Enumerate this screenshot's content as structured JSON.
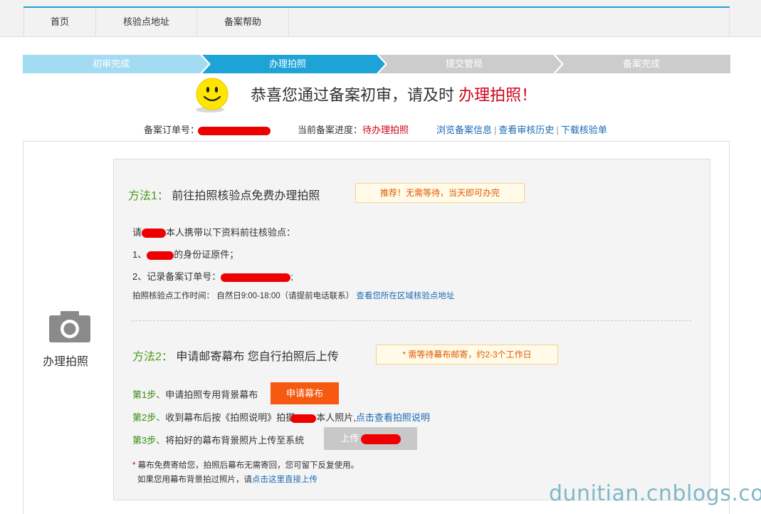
{
  "nav": {
    "items": [
      {
        "label": "首页"
      },
      {
        "label": "核验点地址"
      },
      {
        "label": "备案帮助"
      }
    ]
  },
  "steps": [
    {
      "label": "初审完成",
      "state": "done"
    },
    {
      "label": "办理拍照",
      "state": "current"
    },
    {
      "label": "提交管局",
      "state": "todo"
    },
    {
      "label": "备案完成",
      "state": "todo"
    }
  ],
  "colors": {
    "step_done": "#a3dcf2",
    "step_current": "#1ea3d6",
    "step_todo": "#cccccc",
    "accent_red": "#d0021b",
    "orange_button": "#f55a10",
    "method_green": "#4a9a1a",
    "link_blue": "#1a6bb5"
  },
  "congrats": {
    "text": "恭喜您通过备案初审，请及时",
    "highlight": "办理拍照！"
  },
  "order": {
    "label": "备案订单号：",
    "progress_label": "当前备案进度：",
    "progress_value": "待办理拍照",
    "links": [
      "浏览备案信息",
      "查看审核历史",
      "下载核验单"
    ]
  },
  "side": {
    "icon": "camera-icon",
    "label": "办理拍照"
  },
  "method1": {
    "prefix": "方法1：",
    "title": "前往拍照核验点免费办理拍照",
    "tag": "推荐！无需等待，当天即可办完",
    "intro_a": "请",
    "intro_b": "本人携带以下资料前往核验点：",
    "item1_a": "1、",
    "item1_b": "的身份证原件；",
    "item2_a": "2、记录备案订单号：",
    "item2_b": ";",
    "hours": "拍照核验点工作时间： 自然日9:00-18:00（请提前电话联系）",
    "hours_link": "查看您所在区域核验点地址"
  },
  "method2": {
    "prefix": "方法2：",
    "title": "申请邮寄幕布 您自行拍照后上传",
    "tag": "* 需等待幕布邮寄，约2-3个工作日",
    "step1_a": "第1步、",
    "step1_b": "申请拍照专用背景幕布",
    "step1_button": "申请幕布",
    "step2_a": "第2步、",
    "step2_b": "收到幕布后按《拍照说明》拍摄",
    "step2_c": "本人照片,",
    "step2_link": "点击查看拍照说明",
    "step3_a": "第3步、",
    "step3_b": "将拍好的幕布背景照片上传至系统",
    "step3_button": "上传",
    "note1_star": "*",
    "note1": " 幕布免费寄给您，拍照后幕布无需寄回，您可留下反复使用。",
    "note2": "如果您用幕布背景拍过照片，请",
    "note2_link": "点击这里直接上传"
  },
  "watermark": "dunitian.cnblogs.com"
}
